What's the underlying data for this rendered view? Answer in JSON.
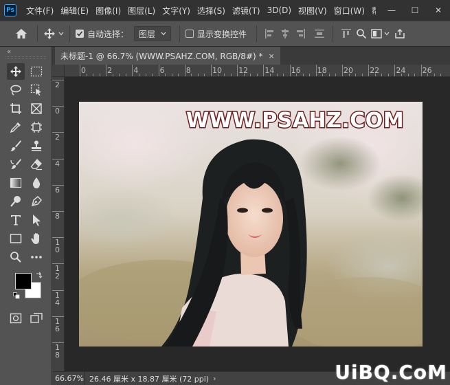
{
  "app": {
    "logo_text": "Ps"
  },
  "menu": [
    "文件(F)",
    "编辑(E)",
    "图像(I)",
    "图层(L)",
    "文字(Y)",
    "选择(S)",
    "滤镜(T)",
    "3D(D)",
    "视图(V)",
    "窗口(W)",
    "帮"
  ],
  "window_controls": {
    "minimize": "—",
    "maximize": "☐",
    "close": "✕"
  },
  "options": {
    "auto_select_label": "自动选择：",
    "auto_select_checked": true,
    "layer_select": "图层",
    "show_transform_label": "显示变换控件",
    "show_transform_checked": false
  },
  "toolbar": {
    "collapse": "«"
  },
  "tab": {
    "title": "未标题-1 @ 66.7% (WWW.PSAHZ.COM, RGB/8#) *",
    "close": "×"
  },
  "rulers": {
    "top": [
      "0",
      "2",
      "4",
      "6",
      "8",
      "10",
      "12",
      "14",
      "16",
      "18",
      "20",
      "22",
      "24",
      "26"
    ],
    "left": [
      "2",
      "0",
      "2",
      "4",
      "6",
      "8",
      "1\n0",
      "1\n2",
      "1\n4",
      "1\n6",
      "1\n8"
    ]
  },
  "canvas": {
    "text": "WWW.PSAHZ.COM",
    "text_color": "#ffffff",
    "stroke_color": "#6b1f1f"
  },
  "status": {
    "zoom": "66.67%",
    "doc_info": "26.46 厘米 x 18.87 厘米 (72 ppi)",
    "arrow": "›"
  },
  "watermark": "UiBQ.CoM"
}
